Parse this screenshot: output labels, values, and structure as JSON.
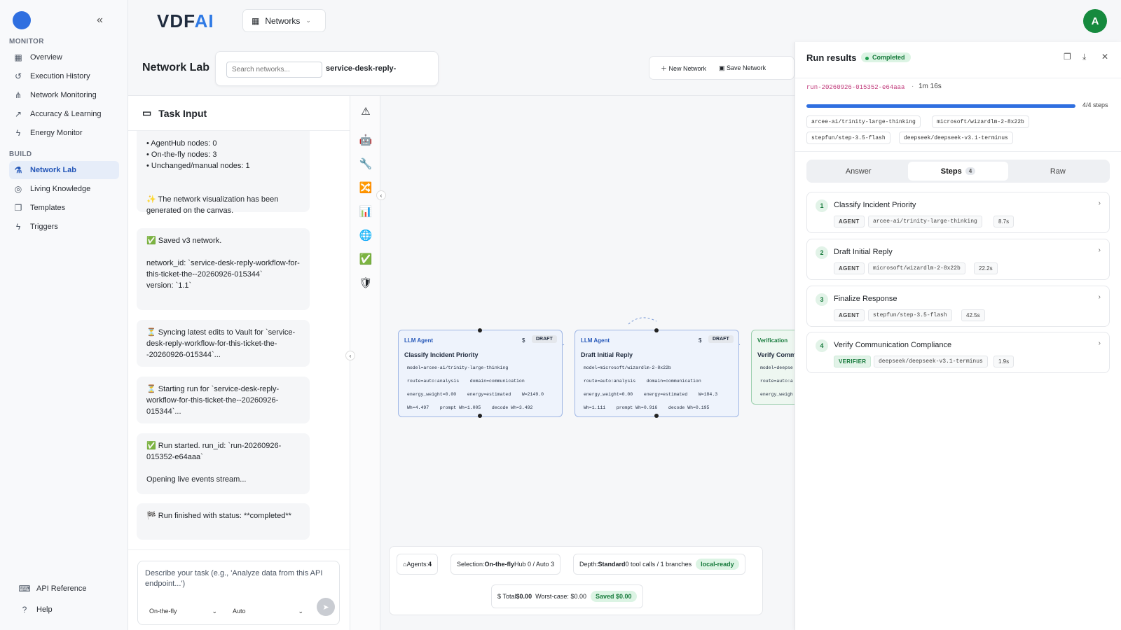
{
  "sidebar": {
    "monitor_label": "MONITOR",
    "build_label": "BUILD",
    "monitor_items": [
      {
        "label": "Overview",
        "icon": "grid-icon"
      },
      {
        "label": "Execution History",
        "icon": "history-icon"
      },
      {
        "label": "Network Monitoring",
        "icon": "network-icon"
      },
      {
        "label": "Accuracy & Learning",
        "icon": "trend-icon"
      },
      {
        "label": "Energy Monitor",
        "icon": "bolt-icon"
      }
    ],
    "build_items": [
      {
        "label": "Network Lab",
        "icon": "flask-icon",
        "active": true
      },
      {
        "label": "Living Knowledge",
        "icon": "brain-icon"
      },
      {
        "label": "Templates",
        "icon": "copy-icon"
      },
      {
        "label": "Triggers",
        "icon": "bolt-icon"
      }
    ],
    "footer_items": [
      {
        "label": "API Reference",
        "icon": "code-icon"
      },
      {
        "label": "Help",
        "icon": "help-icon"
      }
    ]
  },
  "header": {
    "brand_left": "VDF",
    "brand_right": "AI",
    "networks_dropdown": "Networks",
    "avatar_initial": "A"
  },
  "lab": {
    "title": "Network Lab",
    "search_placeholder": "Search networks...",
    "search_value": "service-desk-reply-",
    "new_network": "New Network",
    "save_network": "Save Network"
  },
  "task": {
    "title": "Task Input",
    "messages": [
      "• AgentHub nodes: 0\n• On-the-fly nodes: 3\n• Unchanged/manual nodes: 1\n\n\n✨ The network visualization has been generated on the canvas.",
      "✅ Saved v3 network.\n\nnetwork_id: `service-desk-reply-workflow-for-this-ticket-the--20260926-015344`\nversion: `1.1`",
      "⏳ Syncing latest edits to Vault for `service-desk-reply-workflow-for-this-ticket-the--20260926-015344`...",
      "⏳ Starting run for `service-desk-reply-workflow-for-this-ticket-the--20260926-015344`...",
      "✅ Run started. run_id: `run-20260926-015352-e64aaa`\n\nOpening live events stream...",
      "🏁 Run finished with status: **completed**"
    ],
    "composer_placeholder": "Describe your task (e.g., 'Analyze data from this API endpoint...')",
    "mode_select": "On-the-fly",
    "model_select": "Auto"
  },
  "canvas": {
    "nodes": [
      {
        "type": "LLM Agent",
        "badge": "DRAFT",
        "dollar": "$",
        "title": "Classify Incident Priority",
        "lines": [
          "model=arcee-ai/trinity-large-thinking",
          "route=auto:analysis    domain=communication",
          "energy_weight=0.00    energy=estimated    W=2149.0",
          "Wh=4.497    prompt Wh=1.005    decode Wh=3.492"
        ]
      },
      {
        "type": "LLM Agent",
        "badge": "DRAFT",
        "dollar": "$",
        "title": "Draft Initial Reply",
        "lines": [
          "model=microsoft/wizardlm-2-8x22b",
          "route=auto:analysis    domain=communication",
          "energy_weight=0.00    energy=estimated    W=184.3",
          "Wh=1.111    prompt Wh=0.916    decode Wh=0.195"
        ]
      },
      {
        "type": "Verification",
        "badge": "",
        "dollar": "",
        "title": "Verify Comm",
        "lines": [
          "model=deepse",
          "route=auto:a",
          "energy_weigh"
        ]
      }
    ],
    "stats": {
      "agents_label": "Agents:",
      "agents_value": "4",
      "selection_label": "Selection:",
      "selection_value": "On-the-fly",
      "selection_rest": "Hub 0 / Auto 3",
      "depth_label": "Depth:",
      "depth_value": "Standard",
      "depth_rest": "0 tool calls / 1 branches",
      "ready_badge": "local-ready",
      "total_label": "Total",
      "total_value": "$0.00",
      "worst_case": "Worst-case: $0.00",
      "saved": "Saved $0.00"
    }
  },
  "run": {
    "title": "Run results",
    "status": "Completed",
    "run_id": "run-20260926-015352-e64aaa",
    "separator": "·",
    "duration": "1m 16s",
    "progress_fraction": 1.0,
    "progress_label": "4/4 steps",
    "models": [
      "arcee-ai/trinity-large-thinking",
      "microsoft/wizardlm-2-8x22b",
      "stepfun/step-3.5-flash",
      "deepseek/deepseek-v3.1-terminus"
    ],
    "tabs": {
      "answer": "Answer",
      "steps": "Steps",
      "steps_count": "4",
      "raw": "Raw"
    },
    "steps": [
      {
        "num": "1",
        "title": "Classify Incident Priority",
        "kind": "AGENT",
        "model": "arcee-ai/trinity-large-thinking",
        "time": "8.7s"
      },
      {
        "num": "2",
        "title": "Draft Initial Reply",
        "kind": "AGENT",
        "model": "microsoft/wizardlm-2-8x22b",
        "time": "22.2s"
      },
      {
        "num": "3",
        "title": "Finalize Response",
        "kind": "AGENT",
        "model": "stepfun/step-3.5-flash",
        "time": "42.5s"
      },
      {
        "num": "4",
        "title": "Verify Communication Compliance",
        "kind": "VERIFIER",
        "model": "deepseek/deepseek-v3.1-terminus",
        "time": "1.9s"
      }
    ]
  },
  "colors": {
    "accent": "#2f6fe0",
    "success": "#167a3b",
    "avatar": "#168a3e"
  }
}
